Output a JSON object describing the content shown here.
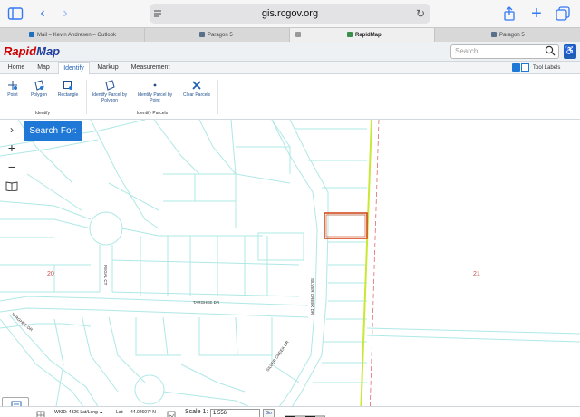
{
  "browser": {
    "url": "gis.rcgov.org",
    "tabs": [
      {
        "label": "Mail – Kevin Andresen – Outlook"
      },
      {
        "label": "Paragon 5"
      },
      {
        "label": ""
      },
      {
        "label": "RapidMap"
      },
      {
        "label": "Paragon 5"
      }
    ]
  },
  "app": {
    "logo_part1": "Rapid",
    "logo_part2": "Map",
    "search_placeholder": "Search...",
    "menu_tabs": [
      "Home",
      "Map",
      "Identify",
      "Markup",
      "Measurement"
    ],
    "active_tab": "Identify",
    "tool_labels": "Tool Labels",
    "ribbon": {
      "identify_buttons": [
        "Point",
        "Polygon",
        "Rectangle"
      ],
      "identify_group": "Identify",
      "parcel_buttons": [
        "Identify Parcel by Polygon",
        "Identify Parcel by Point",
        "Clear Parcels"
      ],
      "parcel_group": "Identify Parcels"
    },
    "search_for": "Search For:"
  },
  "map": {
    "streets": [
      "REGAL CT",
      "TARGHEE DR",
      "SILVER CREEK DR",
      "TARGHEE DR",
      "SILVER CREEK DR"
    ],
    "section_labels": [
      "20",
      "21"
    ],
    "line_color": "#aee8e6",
    "boundary_color": "#c9e836",
    "section_line_color": "#e06a6a",
    "selected_parcel_color": "#d04010"
  },
  "status": {
    "wkid": "WKID: 4326 Lat/Long ▲",
    "lat_label": "Lat:",
    "lat_value": "44.02607° N",
    "scale_label": "Scale 1:",
    "scale_value": "1,556",
    "go": "Go"
  },
  "colors": {
    "accent": "#1f78d6",
    "brand_red": "#cc0000",
    "brand_blue": "#223f9c"
  }
}
